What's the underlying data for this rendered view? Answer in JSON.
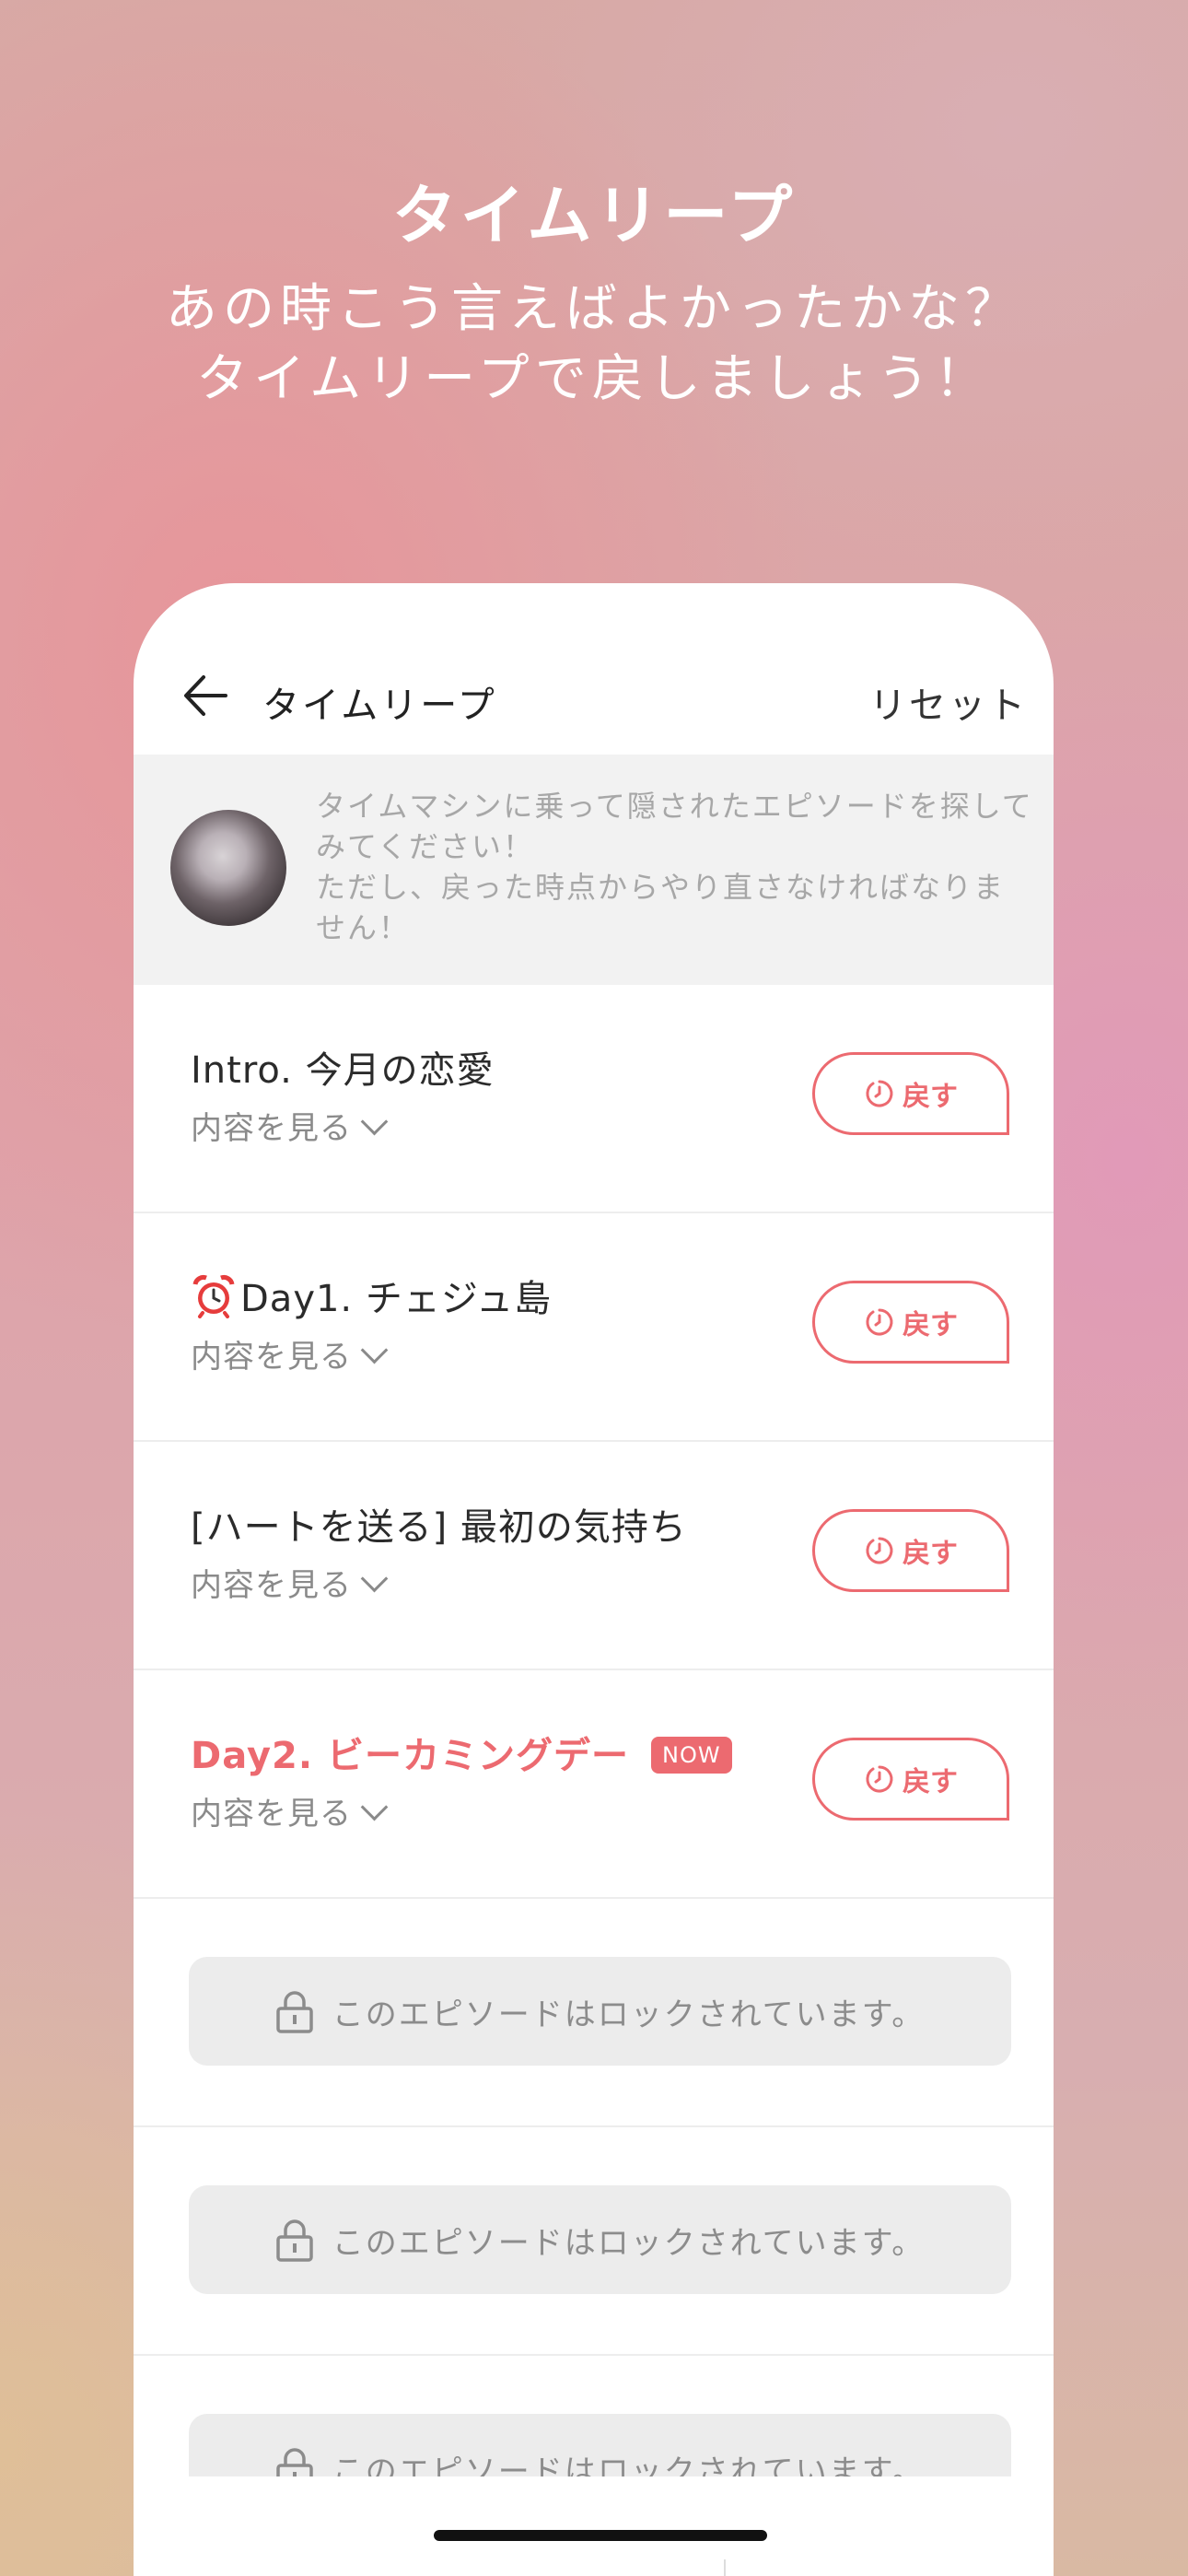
{
  "promo": {
    "title": "タイムリープ",
    "subtitle_line1": "あの時こう言えばよかったかな？",
    "subtitle_line2": "タイムリープで戻しましょう！"
  },
  "nav": {
    "title": "タイムリープ",
    "reset_label": "リセット"
  },
  "notice": {
    "line1": "タイムマシンに乗って隠されたエピソードを探してみてください！",
    "line2": "ただし、戻った時点からやり直さなければなりません！"
  },
  "episodes": [
    {
      "title": "Intro. 今月の恋愛",
      "sub": "内容を見る",
      "button": "戻す"
    },
    {
      "title": "Day1. チェジュ島",
      "sub": "内容を見る",
      "button": "戻す"
    },
    {
      "title": "[ハートを送る] 最初の気持ち",
      "sub": "内容を見る",
      "button": "戻す"
    },
    {
      "title": "Day2. ビーカミングデー",
      "badge": "NOW",
      "sub": "内容を見る",
      "button": "戻す"
    }
  ],
  "locked_text": "このエピソードはロックされています。",
  "colors": {
    "accent": "#ec6a70",
    "muted_text": "#8a8a8a",
    "notice_bg": "#f2f2f2"
  }
}
